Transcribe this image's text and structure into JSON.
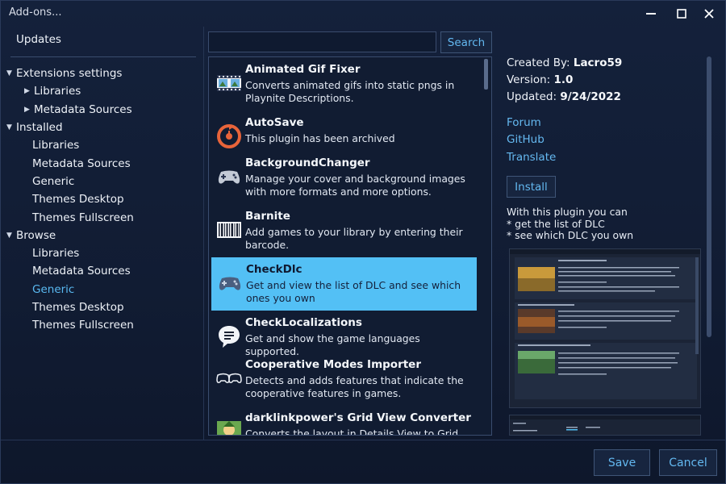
{
  "window": {
    "title": "Add-ons..."
  },
  "nav": {
    "updates": "Updates",
    "extensions_settings": {
      "label": "Extensions settings",
      "children": [
        "Libraries",
        "Metadata Sources"
      ]
    },
    "installed": {
      "label": "Installed",
      "children": [
        "Libraries",
        "Metadata Sources",
        "Generic",
        "Themes Desktop",
        "Themes Fullscreen"
      ]
    },
    "browse": {
      "label": "Browse",
      "children": [
        "Libraries",
        "Metadata Sources",
        "Generic",
        "Themes Desktop",
        "Themes Fullscreen"
      ],
      "selected": "Generic"
    }
  },
  "search": {
    "value": "",
    "button": "Search"
  },
  "addons": [
    {
      "name": "Animated Gif Fixer",
      "description": "Converts animated gifs into static pngs in Playnite Descriptions.",
      "icon": "film-strip-icon"
    },
    {
      "name": "AutoSave",
      "description": "This plugin has been archived",
      "icon": "autosave-icon"
    },
    {
      "name": "BackgroundChanger",
      "description": "Manage your cover and background images with more formats and more options.",
      "icon": "gamepad-icon"
    },
    {
      "name": "Barnite",
      "description": "Add games to your library by entering their barcode.",
      "icon": "barcode-icon"
    },
    {
      "name": "CheckDlc",
      "description": "Get and view the list of DLC and see which ones you own",
      "icon": "gamepad-icon",
      "selected": true
    },
    {
      "name": "CheckLocalizations",
      "description": "Get and show the game languages supported.",
      "icon": "speech-bubble-icon"
    },
    {
      "name": "Cooperative Modes Importer",
      "description": "Detects and adds features that indicate the cooperative features in games.",
      "icon": "two-controllers-icon"
    },
    {
      "name": "darklinkpower's Grid View Converter",
      "description": "Converts the layout in Details View to Grid View of",
      "icon": "character-thumbnail-icon"
    }
  ],
  "details": {
    "created_by_label": "Created By:",
    "created_by": "Lacro59",
    "version_label": "Version:",
    "version": "1.0",
    "updated_label": "Updated:",
    "updated": "9/24/2022",
    "links": [
      "Forum",
      "GitHub",
      "Translate"
    ],
    "install": "Install",
    "text_lines": [
      "With this plugin you can",
      "* get the list of DLC",
      "* see which DLC you own"
    ]
  },
  "footer": {
    "save": "Save",
    "cancel": "Cancel"
  },
  "colors": {
    "accent": "#53c0f5",
    "link": "#65b9f1",
    "background": "#111c33"
  }
}
